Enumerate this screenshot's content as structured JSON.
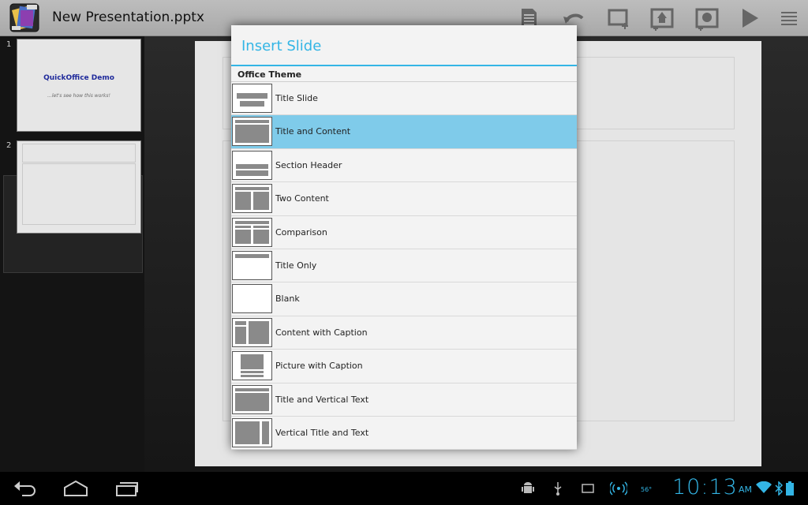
{
  "app": {
    "title": "New Presentation.pptx",
    "icon": "quickoffice-pro-hd-icon"
  },
  "toolbar": {
    "icons": [
      "document-icon",
      "undo-icon",
      "new-slide-icon",
      "insert-image-icon",
      "insert-shape-icon",
      "play-icon",
      "menu-icon"
    ]
  },
  "slides": [
    {
      "number": "1",
      "title": "QuickOffice Demo",
      "subtitle": "...let's see how this works!"
    },
    {
      "number": "2"
    }
  ],
  "dialog": {
    "title": "Insert Slide",
    "section": "Office Theme",
    "selected_index": 1,
    "layouts": [
      {
        "label": "Title Slide",
        "icon": "layout-title-slide-icon"
      },
      {
        "label": "Title and Content",
        "icon": "layout-title-content-icon"
      },
      {
        "label": "Section Header",
        "icon": "layout-section-header-icon"
      },
      {
        "label": "Two Content",
        "icon": "layout-two-content-icon"
      },
      {
        "label": "Comparison",
        "icon": "layout-comparison-icon"
      },
      {
        "label": "Title Only",
        "icon": "layout-title-only-icon"
      },
      {
        "label": "Blank",
        "icon": "layout-blank-icon"
      },
      {
        "label": "Content with Caption",
        "icon": "layout-content-caption-icon"
      },
      {
        "label": "Picture with Caption",
        "icon": "layout-picture-caption-icon"
      },
      {
        "label": "Title and Vertical Text",
        "icon": "layout-title-vertical-text-icon"
      },
      {
        "label": "Vertical Title and Text",
        "icon": "layout-vertical-title-text-icon"
      }
    ]
  },
  "status_bar": {
    "time": "10:13",
    "ampm": "AM",
    "temperature": "56°",
    "icons": [
      "android-debug-icon",
      "usb-icon",
      "screenshot-icon",
      "wireless-icon",
      "wifi-icon",
      "bluetooth-icon",
      "battery-icon"
    ]
  },
  "colors": {
    "accent": "#33b5e5",
    "selected_row": "#7fcbea",
    "thumbnail_title": "#1f2a9b"
  }
}
